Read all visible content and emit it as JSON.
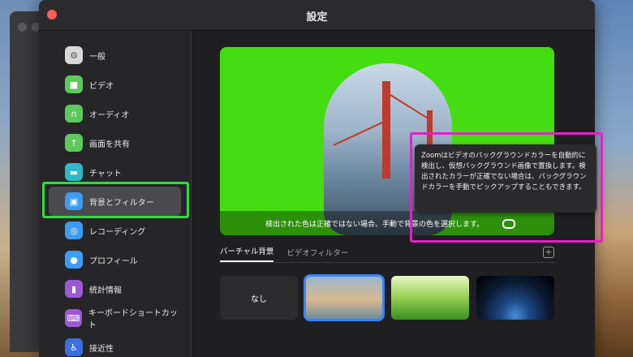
{
  "window": {
    "title": "設定"
  },
  "sidebar": {
    "items": [
      {
        "label": "一般",
        "icon": "gear-icon",
        "color": "#d8d8d8"
      },
      {
        "label": "ビデオ",
        "icon": "camera-icon",
        "color": "#5cc95c"
      },
      {
        "label": "オーディオ",
        "icon": "headphones-icon",
        "color": "#5cc95c"
      },
      {
        "label": "画面を共有",
        "icon": "share-screen-icon",
        "color": "#5cc95c"
      },
      {
        "label": "チャット",
        "icon": "chat-icon",
        "color": "#2fb9c9"
      },
      {
        "label": "背景とフィルター",
        "icon": "background-icon",
        "color": "#3b9cf6",
        "active": true
      },
      {
        "label": "レコーディング",
        "icon": "record-icon",
        "color": "#3b9cf6"
      },
      {
        "label": "プロフィール",
        "icon": "profile-icon",
        "color": "#3b9cf6"
      },
      {
        "label": "統計情報",
        "icon": "stats-icon",
        "color": "#9b59d6"
      },
      {
        "label": "キーボードショートカット",
        "icon": "keyboard-icon",
        "color": "#9b59d6"
      },
      {
        "label": "接近性",
        "icon": "accessibility-icon",
        "color": "#3b6fe0"
      }
    ]
  },
  "preview": {
    "caption": "検出された色は正確ではない場合、手動で背景の色を選択します。"
  },
  "tooltip": {
    "text": "Zoomはビデオのバックグラウンドカラーを自動的に検出し、仮想バックグラウンド画像で置換します。検出されたカラーが正確でない場合は、バックグラウンドカラーを手動でピックアップすることもできます。"
  },
  "tabs": [
    {
      "label": "バーチャル背景",
      "active": true
    },
    {
      "label": "ビデオフィルター",
      "active": false
    }
  ],
  "add_label": "+",
  "thumbnails": {
    "none_label": "なし"
  },
  "colors": {
    "green_screen": "#44dd11",
    "highlight_green": "#31d843",
    "highlight_magenta": "#e61ec8",
    "selected_outline": "#3b82f6"
  }
}
